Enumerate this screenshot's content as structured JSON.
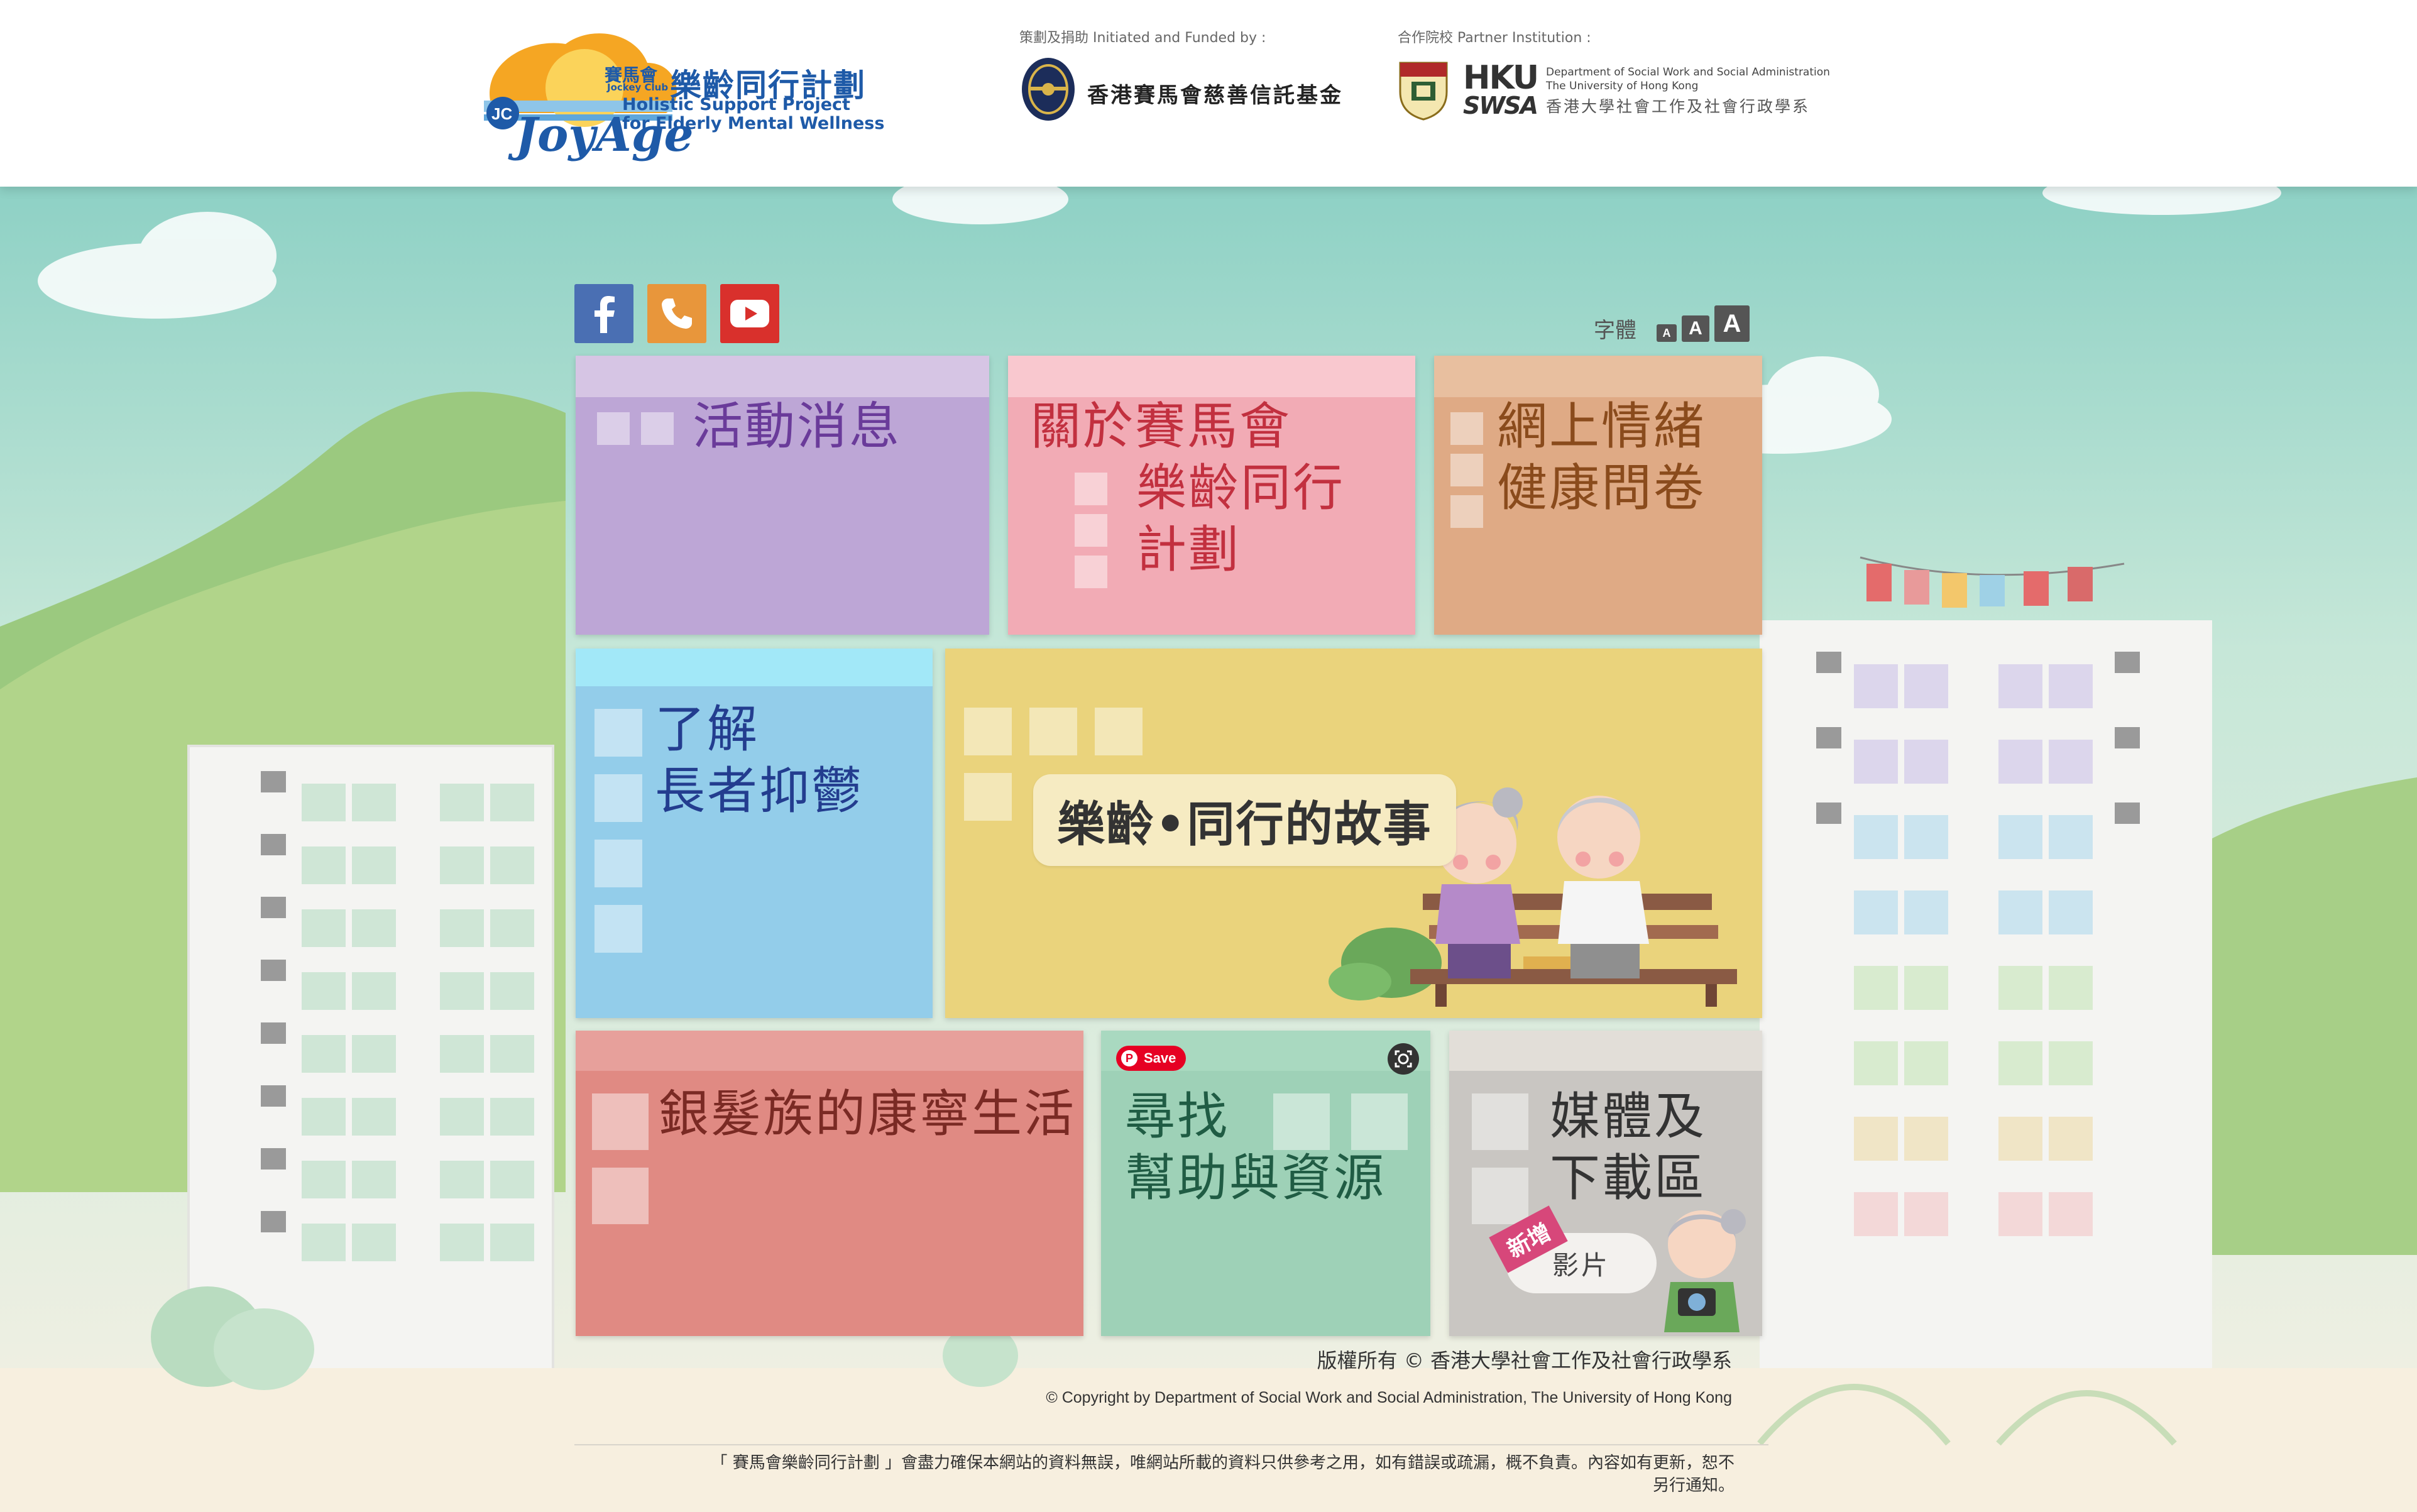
{
  "header": {
    "logo_zh": "樂齡同行計劃",
    "logo_zh_prefix": "賽馬會",
    "logo_jockey": "Jockey Club",
    "logo_brand": "JoyAge",
    "logo_jc": "JC",
    "logo_en_line1": "Holistic Support Project",
    "logo_en_line2": "for Elderly Mental Wellness",
    "funded_caption": "策劃及捐助 Initiated and Funded by :",
    "funded_name": "香港賽馬會慈善信託基金",
    "partner_caption": "合作院校 Partner Institution :",
    "hku_mark_top": "HKU",
    "hku_mark_bottom": "SWSA",
    "hku_dept_line1": "Department of Social Work and Social Administration",
    "hku_dept_line2": "The University of Hong Kong",
    "hku_dept_zh": "香港大學社會工作及社會行政學系"
  },
  "toolbar": {
    "font_size_label": "字體",
    "font_small": "A",
    "font_medium": "A",
    "font_large": "A",
    "social": [
      "facebook-icon",
      "phone-icon",
      "youtube-icon"
    ]
  },
  "tiles": {
    "news": {
      "title": "活動消息",
      "color": "#bda6d6",
      "top_color": "#d6c5e4",
      "text_color": "#6a3b9a"
    },
    "about": {
      "title_line1": "關於賽馬會",
      "title_line2": "樂齡同行",
      "title_line3": "計劃",
      "color": "#f2abb5",
      "top_color": "#f9c8cf",
      "text_color": "#c2303f"
    },
    "survey": {
      "title": "網上情緒\n健康問卷",
      "color": "#dfaa85",
      "top_color": "#e8bf9f",
      "text_color": "#8a4b1c"
    },
    "understand": {
      "title": "了解\n長者抑鬱",
      "color": "#93cdea",
      "top_color": "#a2e8f8",
      "text_color": "#233d8f"
    },
    "story": {
      "label": "樂齡•同行的故事",
      "color": "#ead37c",
      "top_color": "#ead37c"
    },
    "life": {
      "title": "銀髮族的康寧生活",
      "color": "#e08a83",
      "top_color": "#e7a09b",
      "text_color": "#7a2a24"
    },
    "help": {
      "title": "尋找\n幫助與資源",
      "color": "#9ed1b7",
      "top_color": "#a9d9c0",
      "text_color": "#205c44",
      "pin_save": "Save"
    },
    "media": {
      "title": "媒體及\n下載區",
      "color": "#c9c6c2",
      "top_color": "#e2ded8",
      "text_color": "#333333",
      "badge": "新增",
      "video_label": "影片"
    }
  },
  "footer": {
    "copyright_zh": "版權所有 © 香港大學社會工作及社會行政學系",
    "copyright_en": "© Copyright by Department of Social Work and Social Administration, The University of Hong Kong",
    "disclaimer_line1": "「 賽馬會樂齡同行計劃 」會盡力確保本網站的資料無誤，唯網站所載的資料只供參考之用，如有錯誤或疏漏，概不負責。內容如有更新，恕不",
    "disclaimer_line2": "另行通知。"
  }
}
